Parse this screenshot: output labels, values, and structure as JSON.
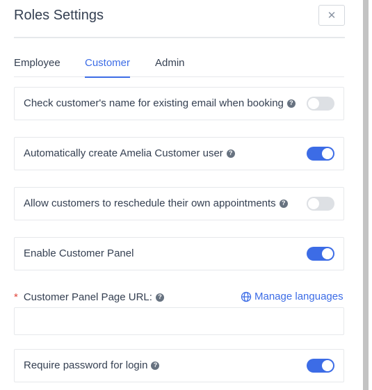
{
  "dialog": {
    "title": "Roles Settings",
    "close_symbol": "✕"
  },
  "tabs": [
    {
      "label": "Employee",
      "active": false
    },
    {
      "label": "Customer",
      "active": true
    },
    {
      "label": "Admin",
      "active": false
    }
  ],
  "settings": [
    {
      "label": "Check customer's name for existing email when booking",
      "help": true,
      "enabled": false
    },
    {
      "label": "Automatically create Amelia Customer user",
      "help": true,
      "enabled": true
    },
    {
      "label": "Allow customers to reschedule their own appointments",
      "help": true,
      "enabled": false
    },
    {
      "label": "Enable Customer Panel",
      "help": false,
      "enabled": true
    },
    {
      "label": "Require password for login",
      "help": true,
      "enabled": true
    }
  ],
  "customer_panel_url": {
    "required_marker": "*",
    "label": "Customer Panel Page URL:",
    "value": "",
    "manage_languages": "Manage languages"
  },
  "help_symbol": "?",
  "colors": {
    "accent": "#3c6ce6",
    "toggle_off": "#dde0e4",
    "required": "#e0453a"
  },
  "icons": {
    "close": "close-icon",
    "help": "help-icon",
    "globe": "globe-icon"
  }
}
